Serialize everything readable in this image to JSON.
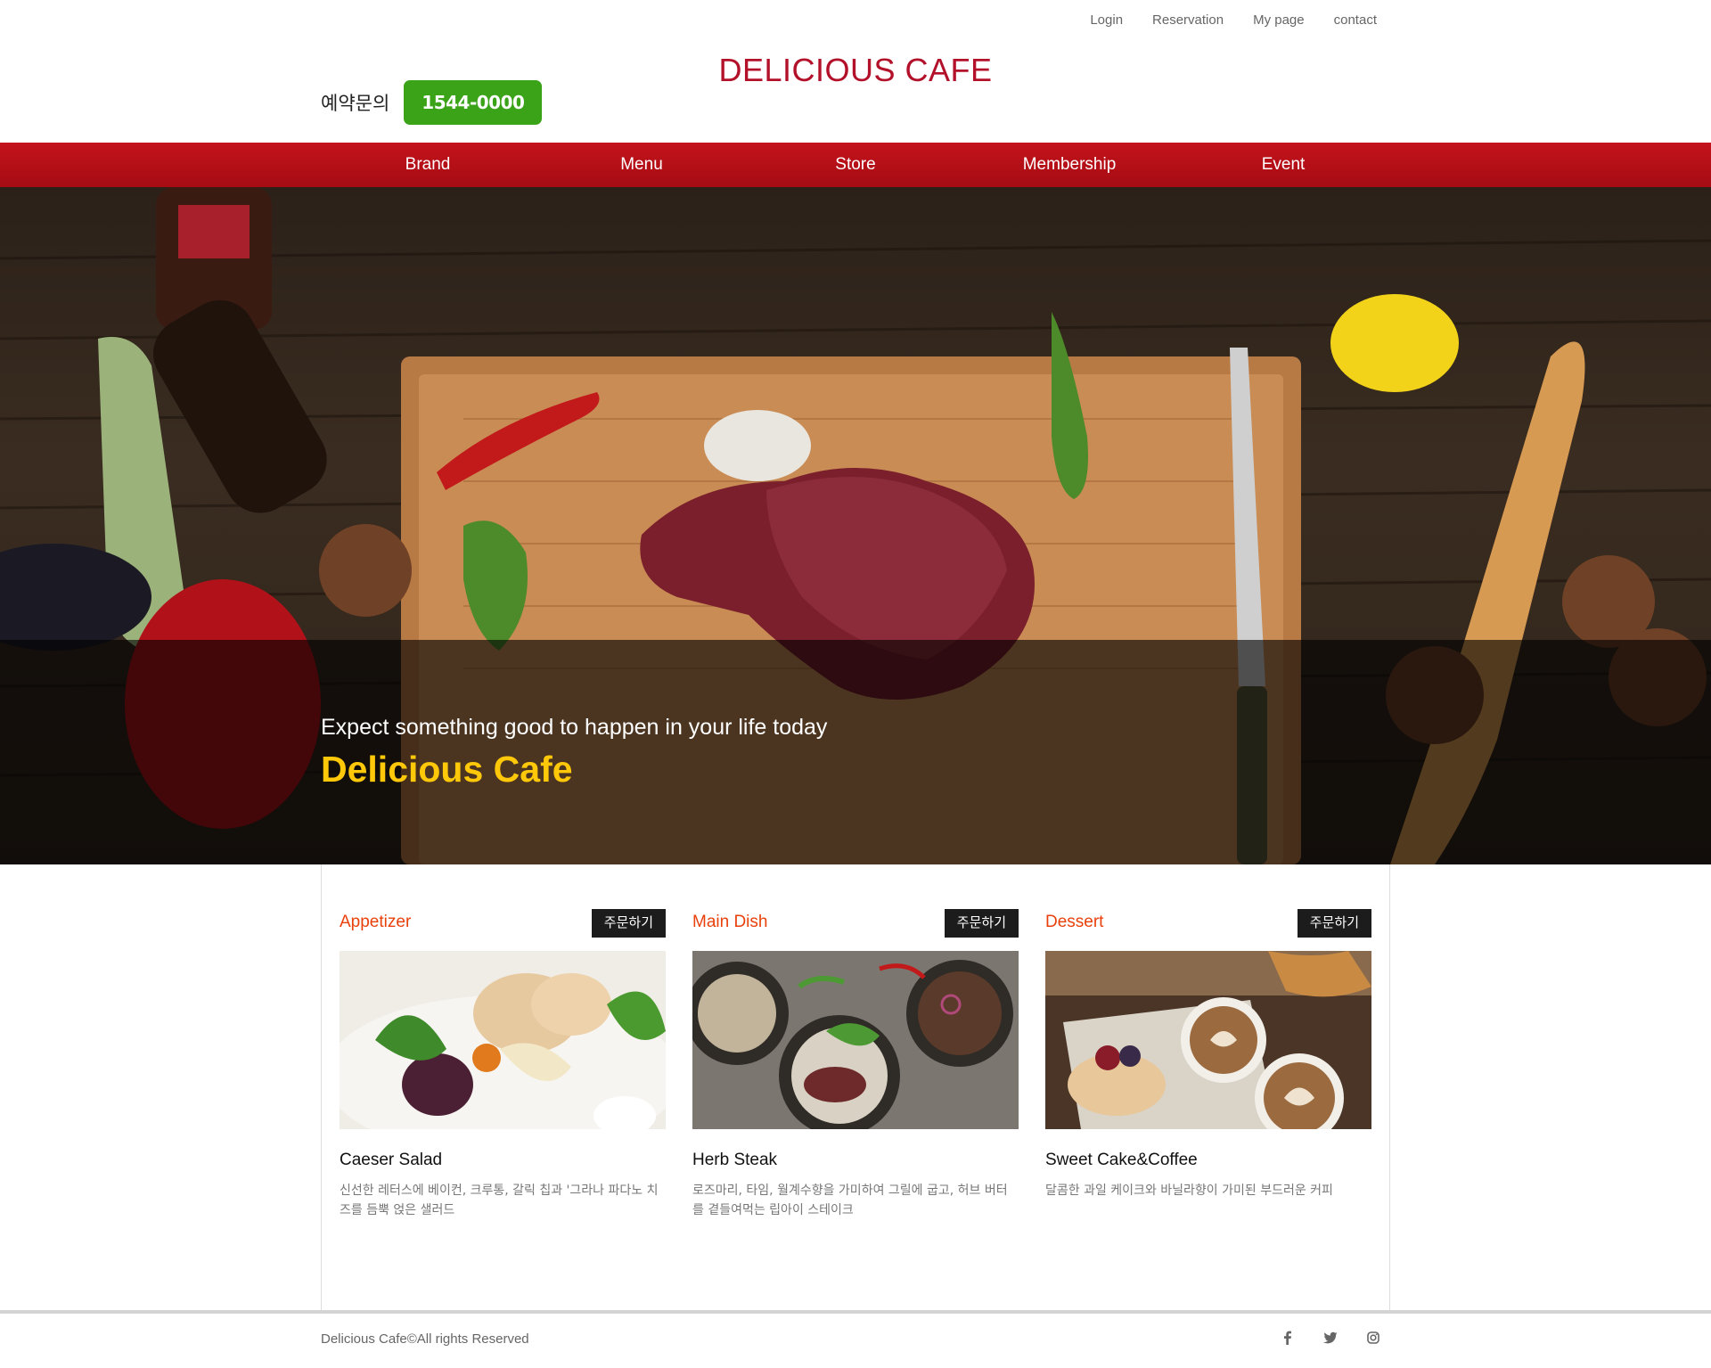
{
  "header": {
    "util_nav": [
      "Login",
      "Reservation",
      "My page",
      "contact"
    ],
    "logo": "DELICIOUS CAFE",
    "reserve_label": "예약문의",
    "reserve_phone": "1544-0000"
  },
  "gnb": [
    "Brand",
    "Menu",
    "Store",
    "Membership",
    "Event"
  ],
  "hero": {
    "subtitle": "Expect something good to happen in your life today",
    "title": "Delicious Cafe"
  },
  "menu": [
    {
      "category": "Appetizer",
      "order_label": "주문하기",
      "name": "Caeser Salad",
      "desc": "신선한 레터스에 베이컨, 크루통, 갈릭 칩과 '그라나 파다노 치즈를 듬뿍 얹은 샐러드"
    },
    {
      "category": "Main Dish",
      "order_label": "주문하기",
      "name": "Herb Steak",
      "desc": "로즈마리, 타임, 월계수향을 가미하여 그릴에 굽고, 허브 버터를 곁들여먹는 립아이 스테이크"
    },
    {
      "category": "Dessert",
      "order_label": "주문하기",
      "name": "Sweet Cake&Coffee",
      "desc": "달콤한 과일 케이크와 바닐라향이 가미된 부드러운 커피"
    }
  ],
  "footer": {
    "copyright": "Delicious Cafe©All rights Reserved",
    "sns": [
      "facebook-icon",
      "twitter-icon",
      "instagram-icon"
    ]
  },
  "colors": {
    "brand_red": "#b3102a",
    "nav_red": "#c4131c",
    "phone_green": "#3aa317",
    "hero_title_yellow": "#ffc90a",
    "category_orange": "#e8410c"
  }
}
